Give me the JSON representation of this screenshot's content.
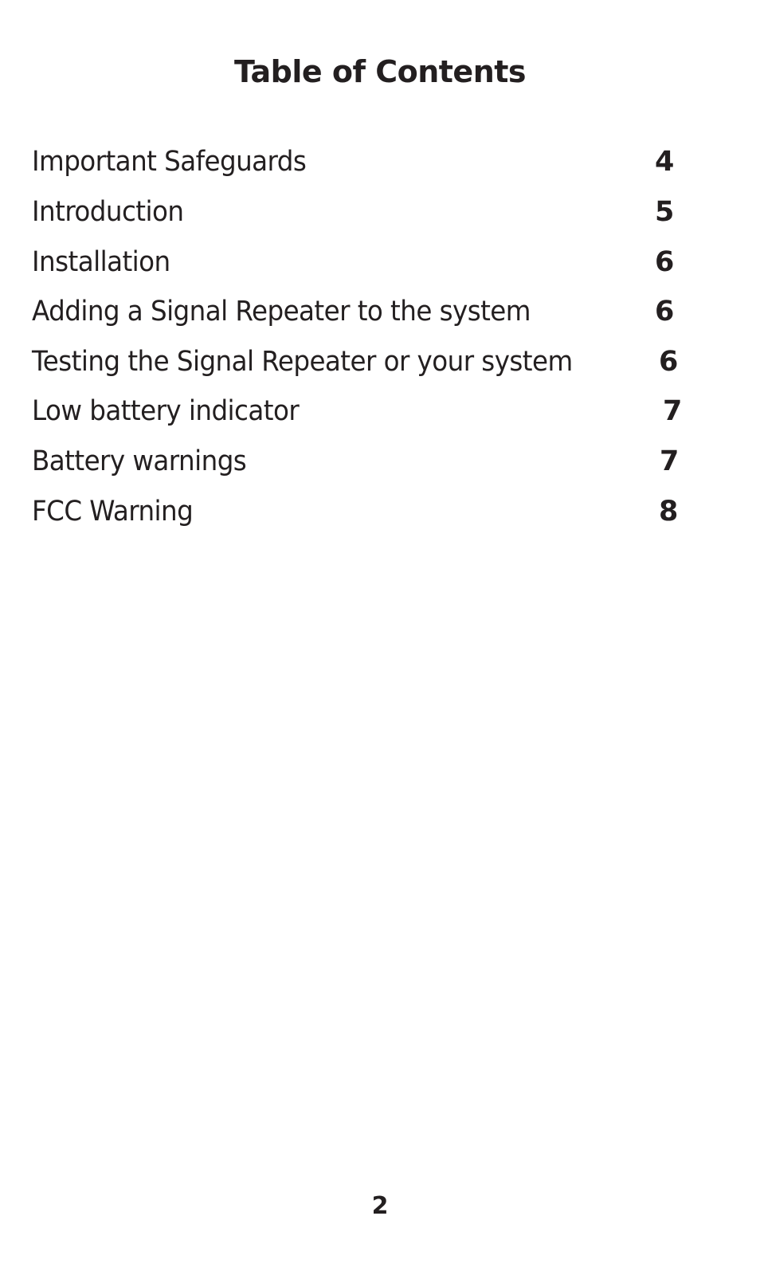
{
  "title": "Table of Contents",
  "entries": [
    {
      "label": "Important Safeguards",
      "page": "4"
    },
    {
      "label": "Introduction",
      "page": "5"
    },
    {
      "label": "Installation",
      "page": "6"
    },
    {
      "label": "Adding a Signal Repeater to the system",
      "page": "6"
    },
    {
      "label": "Testing the Signal Repeater or your system",
      "page": "6"
    },
    {
      "label": "Low battery indicator",
      "page": "7"
    },
    {
      "label": "Battery warnings",
      "page": "7"
    },
    {
      "label": "FCC Warning",
      "page": "8"
    }
  ],
  "page_number": "2"
}
